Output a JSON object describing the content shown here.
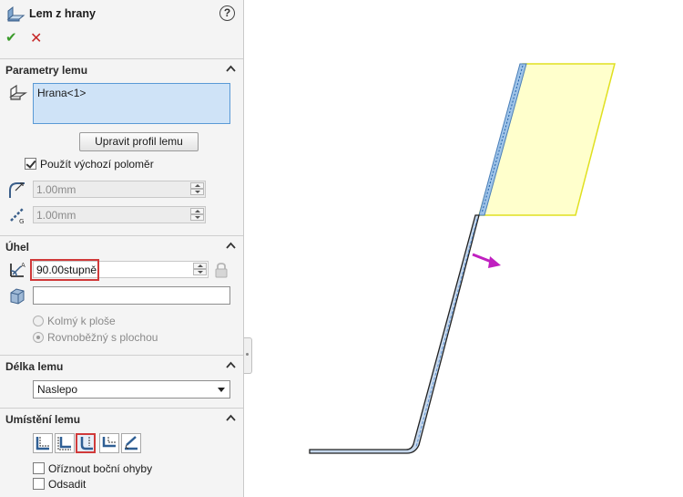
{
  "panel": {
    "title": "Lem z hrany",
    "help_symbol": "?",
    "ok_symbol": "✔",
    "cancel_symbol": "✕"
  },
  "parametry": {
    "header": "Parametry lemu",
    "edge_value": "Hrana<1>",
    "edit_profile_button": "Upravit profil lemu",
    "use_default_radius_label": "Použít výchozí poloměr",
    "use_default_radius_checked": true,
    "radius_value": "1.00mm",
    "gap_value": "1.00mm"
  },
  "uhel": {
    "header": "Úhel",
    "angle_value": "90.00stupně",
    "reference_value": "",
    "perpendicular_label": "Kolmý k ploše",
    "parallel_label": "Rovnoběžný s plochou",
    "selected_option": "parallel"
  },
  "delka": {
    "header": "Délka lemu",
    "selected_value": "Naslepo"
  },
  "umisteni": {
    "header": "Umístění lemu",
    "selected_position_index": 2,
    "trim_side_bends_label": "Oříznout boční ohyby",
    "trim_side_bends_checked": false,
    "offset_label": "Odsadit",
    "offset_checked": false
  },
  "icons": [
    "edge-flange-icon",
    "help-icon",
    "ok-icon",
    "cancel-icon",
    "edge-select-icon",
    "bend-radius-icon",
    "gap-icon",
    "angle-icon",
    "lock-icon",
    "face-reference-icon",
    "chevron-up-icon",
    "dropdown-arrow-icon",
    "flange-position-icon"
  ],
  "colors": {
    "accent_red": "#d03a3a",
    "selection_blue": "#cfe3f7",
    "preview_yellow": "#ffff99",
    "direction_arrow": "#c020c0"
  }
}
